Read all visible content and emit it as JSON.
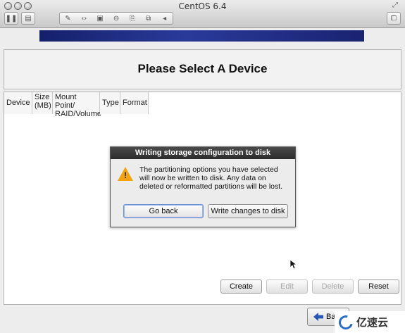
{
  "window": {
    "title": "CentOS 6.4",
    "toolbar_icons": [
      "pause-icon",
      "snapshot-icon",
      "wrench-icon",
      "network-icon",
      "disk-icon",
      "lock-icon",
      "usb-icon",
      "shared-folder-icon",
      "chevron-left-icon"
    ]
  },
  "installer": {
    "heading": "Please Select A Device",
    "table_headers": [
      {
        "line1": "Device",
        "line2": ""
      },
      {
        "line1": "Size",
        "line2": "(MB)"
      },
      {
        "line1": "Mount Point/",
        "line2": "RAID/Volume"
      },
      {
        "line1": "Type",
        "line2": ""
      },
      {
        "line1": "Format",
        "line2": ""
      }
    ],
    "buttons": {
      "create": "Create",
      "edit": "Edit",
      "delete": "Delete",
      "reset": "Reset",
      "back": "Ba"
    }
  },
  "dialog": {
    "title": "Writing storage configuration to disk",
    "message": "The partitioning options you have selected\nwill now be written to disk.  Any data on\ndeleted or reformatted partitions will be lost.",
    "go_back": "Go back",
    "write": "Write changes to disk"
  },
  "watermark": {
    "text": "亿速云"
  }
}
